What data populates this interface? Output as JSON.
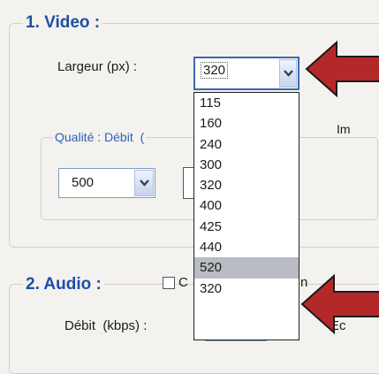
{
  "video_group": {
    "title": "1. Video :",
    "width_label": "Largeur (px) :",
    "width_value": "320",
    "quality_title": "Qualité : Débit",
    "quality_title_suffix": "(",
    "bitrate_value": "500",
    "right_truncated": "Im"
  },
  "width_dropdown": {
    "options": [
      "115",
      "160",
      "240",
      "300",
      "320",
      "400",
      "425",
      "440",
      "520",
      "320"
    ],
    "highlighted_index": 8
  },
  "audio_group": {
    "title": "2. Audio :",
    "checkbox_suffix": "C",
    "bitrate_label": "Débit  (kbps) :",
    "right_truncated": "Ec",
    "behind_text": "n"
  },
  "colors": {
    "title_blue": "#1f4fa6",
    "arrow_red": "#b5282a",
    "highlight": "#b9bcc4"
  }
}
